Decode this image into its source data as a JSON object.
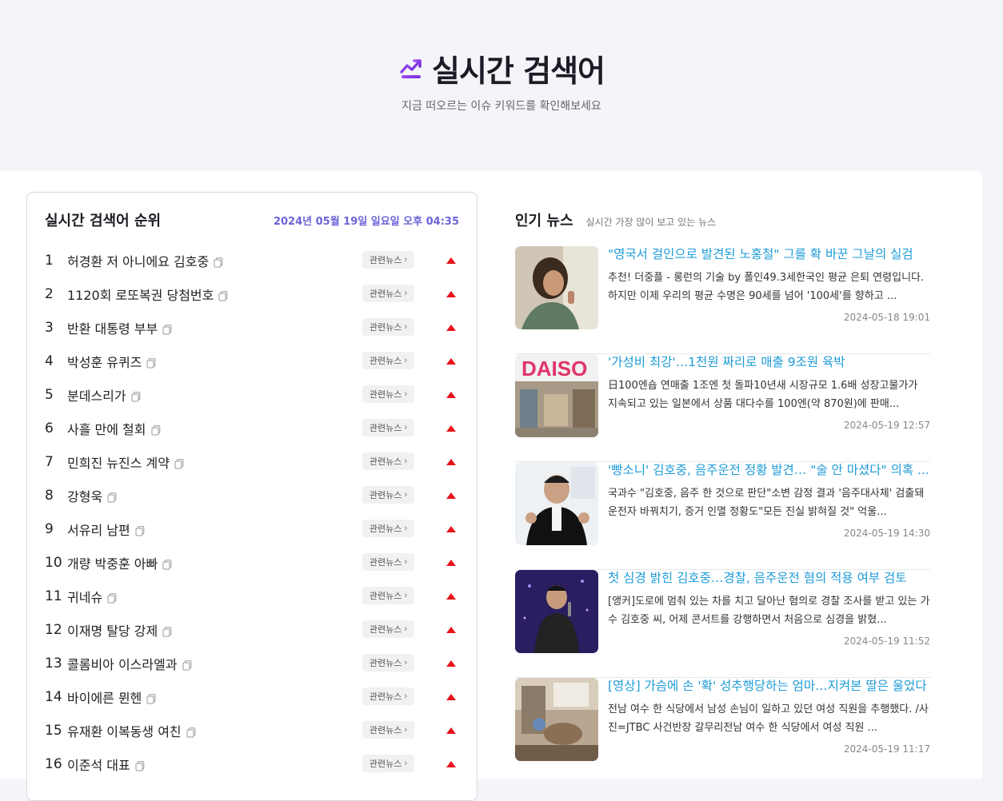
{
  "hero": {
    "title": "실시간 검색어",
    "subtitle": "지금 떠오르는 이슈 키워드를 확인해보세요",
    "accent_color": "#7b3fe4"
  },
  "ranking": {
    "title": "실시간 검색어 순위",
    "datetime": "2024년 05월 19일 일요일 오후 04:35",
    "news_button_label": "관련뉴스",
    "trend_color": "#e8141c",
    "items": [
      {
        "rank": "1",
        "keyword": "허경환 저 아니에요 김호중"
      },
      {
        "rank": "2",
        "keyword": "1120회 로또복권 당첨번호"
      },
      {
        "rank": "3",
        "keyword": "반환 대통령 부부"
      },
      {
        "rank": "4",
        "keyword": "박성훈 유퀴즈"
      },
      {
        "rank": "5",
        "keyword": "분데스리가"
      },
      {
        "rank": "6",
        "keyword": "사흘 만에 철회"
      },
      {
        "rank": "7",
        "keyword": "민희진 뉴진스 계약"
      },
      {
        "rank": "8",
        "keyword": "강형욱"
      },
      {
        "rank": "9",
        "keyword": "서유리 남편"
      },
      {
        "rank": "10",
        "keyword": "개량 박중훈 아빠"
      },
      {
        "rank": "11",
        "keyword": "귀네슈"
      },
      {
        "rank": "12",
        "keyword": "이재명 탈당 강제"
      },
      {
        "rank": "13",
        "keyword": "콜롬비아 이스라엘과"
      },
      {
        "rank": "14",
        "keyword": "바이에른 뮌헨"
      },
      {
        "rank": "15",
        "keyword": "유재환 이복동생 여친"
      },
      {
        "rank": "16",
        "keyword": "이준석 대표"
      }
    ]
  },
  "news": {
    "title": "인기 뉴스",
    "subtitle": "실시간 가장 많이 보고 있는 뉴스",
    "headline_color": "#1e9bd7",
    "items": [
      {
        "headline": "\"영국서 걸인으로 발견된 노홍철\" 그를 확 바꾼 그날의 실검",
        "summary": "추천! 더중플 - 롱런의 기술 by 폴인49.3세한국인 평균 은퇴 연령입니다. 하지만 이제 우리의 평균 수명은 90세를 넘어 '100세'를 향하고 ...",
        "date": "2024-05-18 19:01"
      },
      {
        "headline": "'가성비 최강'…1천원 짜리로 매출 9조원 육박",
        "summary": "日100엔숍 연매출 1조엔 첫 돌파10년새 시장규모 1.6배 성장고물가가 지속되고 있는 일본에서 상품 대다수를 100엔(약 870원)에 판매...",
        "date": "2024-05-19 12:57"
      },
      {
        "headline": "'빵소니' 김호중, 음주운전 정황 발견… \"술 안 마셨다\" 의혹 ...",
        "summary": "국과수 \"김호중, 음주 한 것으로 판단\"소변 감정 결과 '음주대사체' 검출돼운전자 바꿔치기, 증거 인멸 정황도\"모든 진실 밝혀질 것\" 억울...",
        "date": "2024-05-19 14:30"
      },
      {
        "headline": "첫 심경 밝힌 김호중…경찰, 음주운전 혐의 적용 여부 검토",
        "summary": "[앵커]도로에 멈춰 있는 차를 치고 달아난 혐의로 경찰 조사를 받고 있는 가수 김호중 씨, 어제 콘서트를 강행하면서 처음으로 심경을 밝혔...",
        "date": "2024-05-19 11:52"
      },
      {
        "headline": "[영상] 가슴에 손 '확' 성추행당하는 엄마…지켜본 딸은 울었다",
        "summary": "전남 여수 한 식당에서 남성 손님이 일하고 있던 여성 직원을 추행했다. /사진=JTBC 사건반장 갈무리전남 여수 한 식당에서 여성 직원 ...",
        "date": "2024-05-19 11:17"
      }
    ],
    "thumb2_sign": "DAISO"
  }
}
